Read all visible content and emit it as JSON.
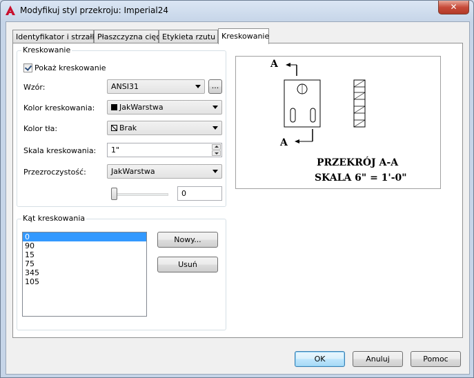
{
  "window": {
    "title": "Modyfikuj styl przekroju: Imperial24",
    "close_glyph": "✕"
  },
  "tabs": [
    {
      "label": "Identyfikator i strzałki"
    },
    {
      "label": "Płaszczyzna cięcia"
    },
    {
      "label": "Etykieta rzutu"
    },
    {
      "label": "Kreskowanie"
    }
  ],
  "hatching": {
    "group_title": "Kreskowanie",
    "show_hatch_label": "Pokaż kreskowanie",
    "show_hatch_checked": true,
    "pattern_label": "Wzór:",
    "pattern_value": "ANSI31",
    "browse_label": "...",
    "hatch_color_label": "Kolor kreskowania:",
    "hatch_color_value": "JakWarstwa",
    "bg_color_label": "Kolor tła:",
    "bg_color_value": "Brak",
    "scale_label": "Skala kreskowania:",
    "scale_value": "1\"",
    "transparency_label": "Przezroczystość:",
    "transparency_value": "JakWarstwa",
    "transparency_amount": "0"
  },
  "angle": {
    "group_title": "Kąt kreskowania",
    "items": [
      "0",
      "90",
      "15",
      "75",
      "345",
      "105"
    ],
    "selected_index": 0,
    "new_label": "Nowy...",
    "delete_label": "Usuń"
  },
  "preview": {
    "label_a_top": "A",
    "label_a_bottom": "A",
    "caption_line1": "PRZEKRÓJ A-A",
    "caption_line2": "SKALA 6\" = 1'-0\""
  },
  "footer": {
    "ok_label": "OK",
    "cancel_label": "Anuluj",
    "help_label": "Pomoc"
  }
}
